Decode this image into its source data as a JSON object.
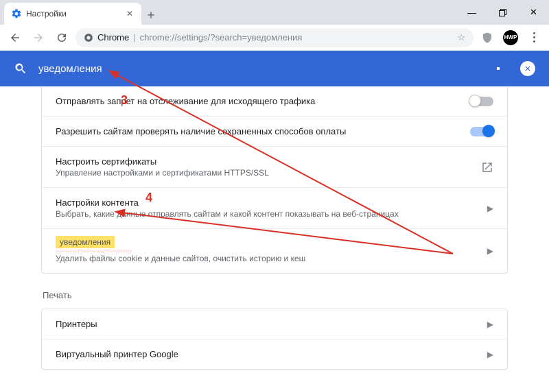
{
  "window": {
    "tab_title": "Настройки",
    "new_tab_icon": "+",
    "minimize": "—",
    "maximize": "☐",
    "close": "✕"
  },
  "addr": {
    "secure_label": "Chrome",
    "url_rest": "chrome://settings/?search=уведомления",
    "star_icon": "☆",
    "shield_icon": "⛨",
    "avatar_text": "HWP"
  },
  "search": {
    "value": "уведомления",
    "clear_icon": "✕"
  },
  "rows": {
    "dnt": {
      "title": "Отправлять запрет на отслеживание для исходящего трафика"
    },
    "pay": {
      "title": "Разрешить сайтам проверять наличие сохраненных способов оплаты"
    },
    "certs": {
      "title": "Настроить сертификаты",
      "sub": "Управление настройками и сертификатами HTTPS/SSL"
    },
    "content": {
      "title": "Настройки контента",
      "sub": "Выбрать, какие данные отправлять сайтам и какой контент показывать на веб-страницах"
    },
    "clear": {
      "highlight": "уведомления",
      "struck": "Очистить историю",
      "sub": "Удалить файлы cookie и данные сайтов, очистить историю и кеш"
    }
  },
  "print_section": {
    "label": "Печать",
    "printers": "Принтеры",
    "gcp": "Виртуальный принтер Google"
  },
  "annotations": {
    "n3": "3",
    "n4": "4"
  }
}
